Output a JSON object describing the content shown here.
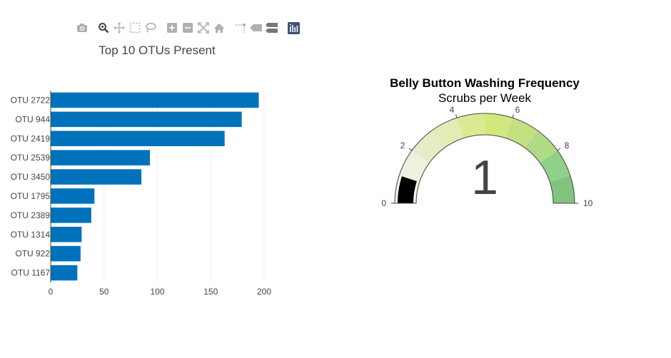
{
  "modebar": {
    "buttons": [
      {
        "name": "camera-icon"
      },
      {
        "name": "zoom-icon"
      },
      {
        "name": "pan-icon"
      },
      {
        "name": "box-select-icon"
      },
      {
        "name": "lasso-select-icon"
      },
      {
        "name": "zoom-in-icon"
      },
      {
        "name": "zoom-out-icon"
      },
      {
        "name": "autoscale-icon"
      },
      {
        "name": "reset-axes-icon"
      },
      {
        "name": "spike-lines-icon"
      },
      {
        "name": "hover-closest-icon"
      },
      {
        "name": "hover-compare-icon"
      },
      {
        "name": "plotly-logo-icon"
      }
    ]
  },
  "chart_data": [
    {
      "type": "bar",
      "orientation": "horizontal",
      "title": "Top 10 OTUs Present",
      "categories": [
        "OTU 2722",
        "OTU 944",
        "OTU 2419",
        "OTU 2539",
        "OTU 3450",
        "OTU 1795",
        "OTU 2389",
        "OTU 1314",
        "OTU 922",
        "OTU 1167"
      ],
      "values": [
        195,
        179,
        163,
        93,
        85,
        41,
        38,
        29,
        28,
        25
      ],
      "xticks": [
        "0",
        "50",
        "100",
        "150",
        "200"
      ],
      "xlim": [
        0,
        210
      ],
      "grid": true,
      "color": "#0072bc"
    },
    {
      "type": "gauge",
      "title": "Belly Button Washing Frequency",
      "subtitle": "Scrubs per Week",
      "value": 1,
      "value_label": "1",
      "range": [
        0,
        10
      ],
      "ticks": [
        "0",
        "2",
        "4",
        "6",
        "8",
        "10"
      ],
      "bar_color": "#000000",
      "steps": [
        {
          "range": [
            0,
            1
          ],
          "color": "#f4f1e6"
        },
        {
          "range": [
            1,
            2
          ],
          "color": "#f0f0de"
        },
        {
          "range": [
            2,
            3
          ],
          "color": "#e6ebc8"
        },
        {
          "range": [
            3,
            4
          ],
          "color": "#e2edb5"
        },
        {
          "range": [
            4,
            5
          ],
          "color": "#d9ea92"
        },
        {
          "range": [
            5,
            6
          ],
          "color": "#d1e87c"
        },
        {
          "range": [
            6,
            7
          ],
          "color": "#c3e083"
        },
        {
          "range": [
            7,
            8
          ],
          "color": "#aedb84"
        },
        {
          "range": [
            8,
            9
          ],
          "color": "#8fd18a"
        },
        {
          "range": [
            9,
            10
          ],
          "color": "#82c47f"
        }
      ]
    }
  ]
}
